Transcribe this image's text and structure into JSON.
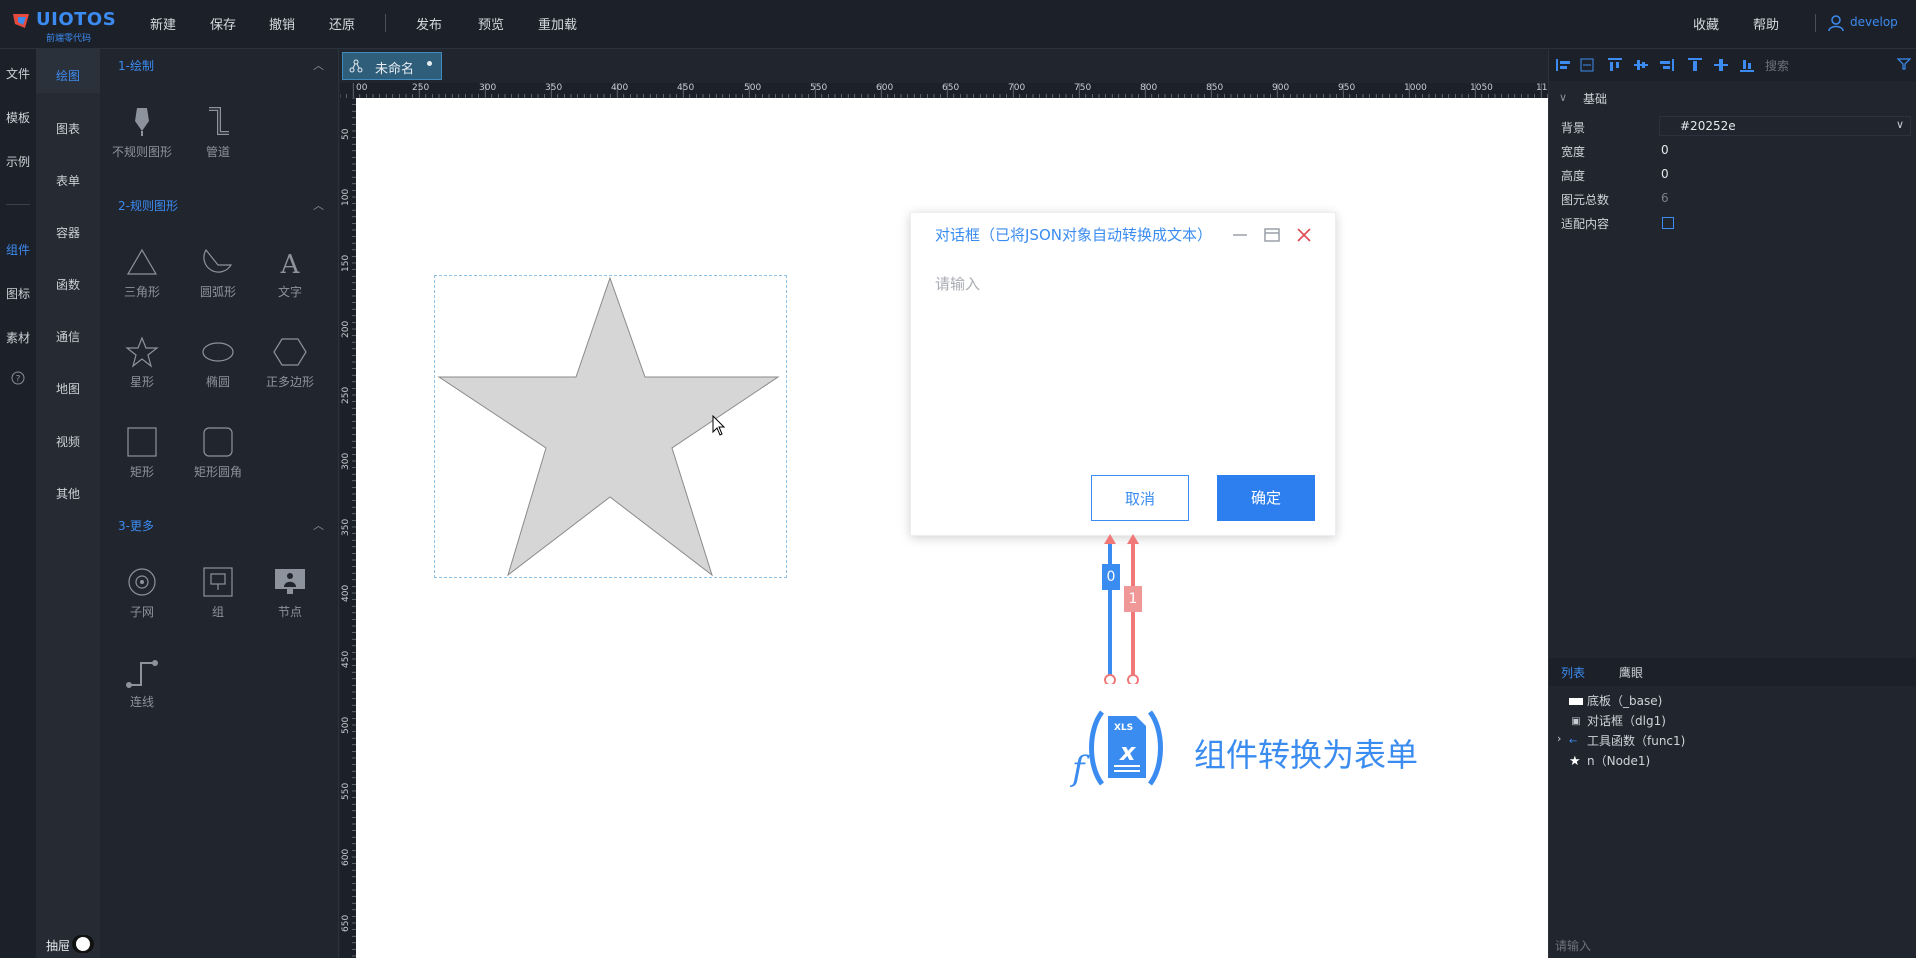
{
  "app": {
    "logo_name": "UIOTOS",
    "logo_sub": "前端零代码",
    "user": "develop"
  },
  "topmenu": [
    "新建",
    "保存",
    "撤销",
    "还原",
    "发布",
    "预览",
    "重加载"
  ],
  "topright": [
    "收藏",
    "帮助"
  ],
  "leftnav1": [
    "文件",
    "模板",
    "示例",
    "组件",
    "图标",
    "素材"
  ],
  "leftnav1_active": "组件",
  "leftnav2": [
    "绘图",
    "图表",
    "表单",
    "容器",
    "函数",
    "通信",
    "地图",
    "视频",
    "其他"
  ],
  "leftnav2_active": "绘图",
  "palette": {
    "sections": [
      {
        "title": "1-绘制",
        "items": [
          "不规则图形",
          "管道"
        ]
      },
      {
        "title": "2-规则图形",
        "items": [
          "三角形",
          "圆弧形",
          "文字",
          "星形",
          "椭圆",
          "正多边形",
          "矩形",
          "矩形圆角"
        ]
      },
      {
        "title": "3-更多",
        "items": [
          "子网",
          "组",
          "节点",
          "连线"
        ]
      }
    ]
  },
  "layer_toggle": "抽屉",
  "tab": {
    "title": "未命名"
  },
  "ruler": {
    "h": [
      "00",
      "250",
      "300",
      "350",
      "400",
      "450",
      "500",
      "550",
      "600",
      "650",
      "700",
      "750",
      "800",
      "850",
      "900",
      "950",
      "1000",
      "1050",
      "11"
    ],
    "v": [
      "50",
      "100",
      "150",
      "200",
      "250",
      "300",
      "350",
      "400",
      "450",
      "500",
      "550",
      "600",
      "650"
    ]
  },
  "dialog": {
    "title": "对话框（已将JSON对象自动转换成文本）",
    "placeholder": "请输入",
    "cancel": "取消",
    "ok": "确定"
  },
  "link_labels": [
    "0",
    "1"
  ],
  "func_caption": "组件转换为表单",
  "func_icon_text": "XLS",
  "right": {
    "search_placeholder": "搜索",
    "section": "基础",
    "props": [
      {
        "label": "背景",
        "value": "#20252e"
      },
      {
        "label": "宽度",
        "value": "0"
      },
      {
        "label": "高度",
        "value": "0"
      },
      {
        "label": "图元总数",
        "value": "6"
      },
      {
        "label": "适配内容",
        "value": ""
      }
    ],
    "tabs": [
      "列表",
      "鹰眼"
    ],
    "tree": [
      {
        "label": "底板（_base)"
      },
      {
        "label": "对话框（dlg1)"
      },
      {
        "label": "工具函数（func1)"
      },
      {
        "label": "n（Node1)"
      }
    ],
    "bottom_input": "请输入"
  },
  "colors": {
    "accent": "#3c8bf0",
    "bg": "#20252e",
    "link_blue": "#3b8cf0",
    "link_red": "#f07878"
  }
}
